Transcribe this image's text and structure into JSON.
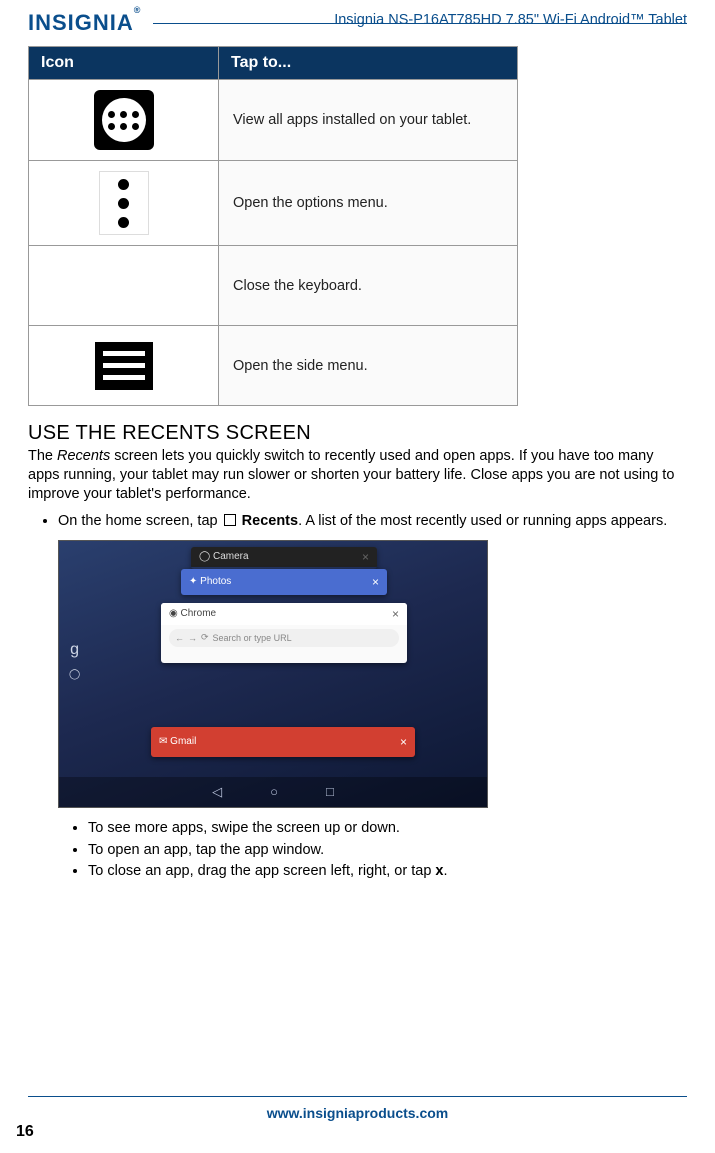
{
  "header": {
    "brand": "INSIGNIA",
    "product": "Insignia  NS-P16AT785HD  7.85\" Wi-Fi Android™ Tablet"
  },
  "table": {
    "headers": {
      "icon": "Icon",
      "tap": "Tap to..."
    },
    "rows": [
      {
        "desc": "View all apps installed on your tablet."
      },
      {
        "desc": "Open the options menu."
      },
      {
        "desc": "Close the keyboard."
      },
      {
        "desc": "Open the side menu."
      }
    ]
  },
  "section": {
    "title": "USE THE RECENTS SCREEN",
    "intro_pre": "The ",
    "intro_em": "Recents",
    "intro_post": " screen lets you quickly switch to recently used and open apps. If you have too many apps running, your tablet may run slower or shorten your battery life. Close apps you are not using to improve your tablet's performance.",
    "bullet_pre": "On the home screen, tap ",
    "bullet_strong": "Recents",
    "bullet_post": ". A list of the most recently used or running apps appears.",
    "sub_bullets": [
      "To see more apps, swipe the screen up or down.",
      "To open an app, tap the app window."
    ],
    "sub_bullet_close_pre": "To close an app, drag the app screen left, right, or tap ",
    "sub_bullet_close_bold": "x",
    "sub_bullet_close_post": "."
  },
  "screenshot": {
    "cards": {
      "camera": "Camera",
      "photos": "Photos",
      "chrome": "Chrome",
      "url_hint": "Search or type URL",
      "gmail": "Gmail"
    },
    "google_g": "g"
  },
  "footer": {
    "url": "www.insigniaproducts.com",
    "page": "16"
  }
}
